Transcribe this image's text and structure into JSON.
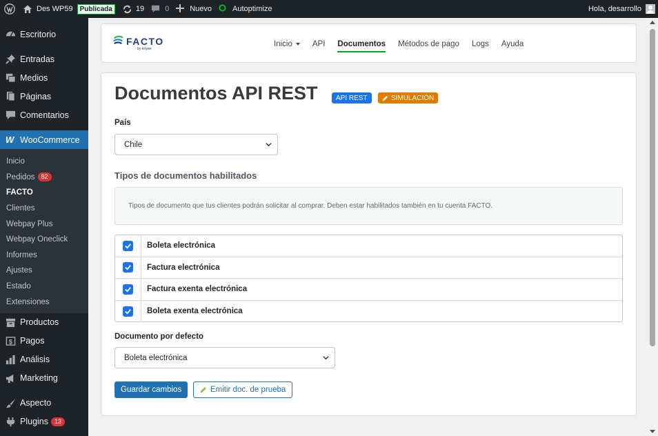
{
  "adminbar": {
    "site_name": "Des WP59",
    "status_badge": "Publicada",
    "updates_count": "19",
    "comments_count": "0",
    "new_label": "Nuevo",
    "autoptimize_label": "Autoptimize",
    "greeting": "Hola, desarrollo"
  },
  "sidebar": {
    "items_top": [
      "Escritorio",
      "Entradas",
      "Medios",
      "Páginas",
      "Comentarios"
    ],
    "woocommerce": "WooCommerce",
    "submenu": {
      "inicio": "Inicio",
      "pedidos": "Pedidos",
      "pedidos_count": "82",
      "facto": "FACTO",
      "clientes": "Clientes",
      "webpay_plus": "Webpay Plus",
      "webpay_oneclick": "Webpay Oneclick",
      "informes": "Informes",
      "ajustes": "Ajustes",
      "estado": "Estado",
      "extensiones": "Extensiones"
    },
    "items_bottom": [
      "Productos",
      "Pagos",
      "Análisis",
      "Marketing",
      "Aspecto"
    ],
    "plugins": "Plugins",
    "plugins_count": "13"
  },
  "navbar": {
    "logo_text": "FACTO",
    "logo_sub": "by koywe",
    "items": [
      "Inicio",
      "API",
      "Documentos",
      "Métodos de pago",
      "Logs",
      "Ayuda"
    ]
  },
  "main": {
    "title": "Documentos API REST",
    "badge_api": "API REST",
    "badge_sim": "SIMULACIÓN",
    "pais_label": "País",
    "pais_value": "Chile",
    "section_title": "Tipos de documentos habilitados",
    "info_text": "Tipos de documento que tus clientes podrán solicitar al comprar. Deben estar habilitados también en tu cuenta FACTO.",
    "documents": [
      {
        "label": "Boleta electrónica",
        "checked": true
      },
      {
        "label": "Factura electrónica",
        "checked": true
      },
      {
        "label": "Factura exenta electrónica",
        "checked": true
      },
      {
        "label": "Boleta exenta electrónica",
        "checked": true
      }
    ],
    "default_label": "Documento por defecto",
    "default_value": "Boleta electrónica",
    "save_button": "Guardar cambios",
    "test_button": "Emitir doc. de prueba"
  },
  "colors": {
    "accent": "#2271b1",
    "checkbox": "#1a73e8",
    "simulation": "#e07b00",
    "active_tab": "#00a32a"
  }
}
